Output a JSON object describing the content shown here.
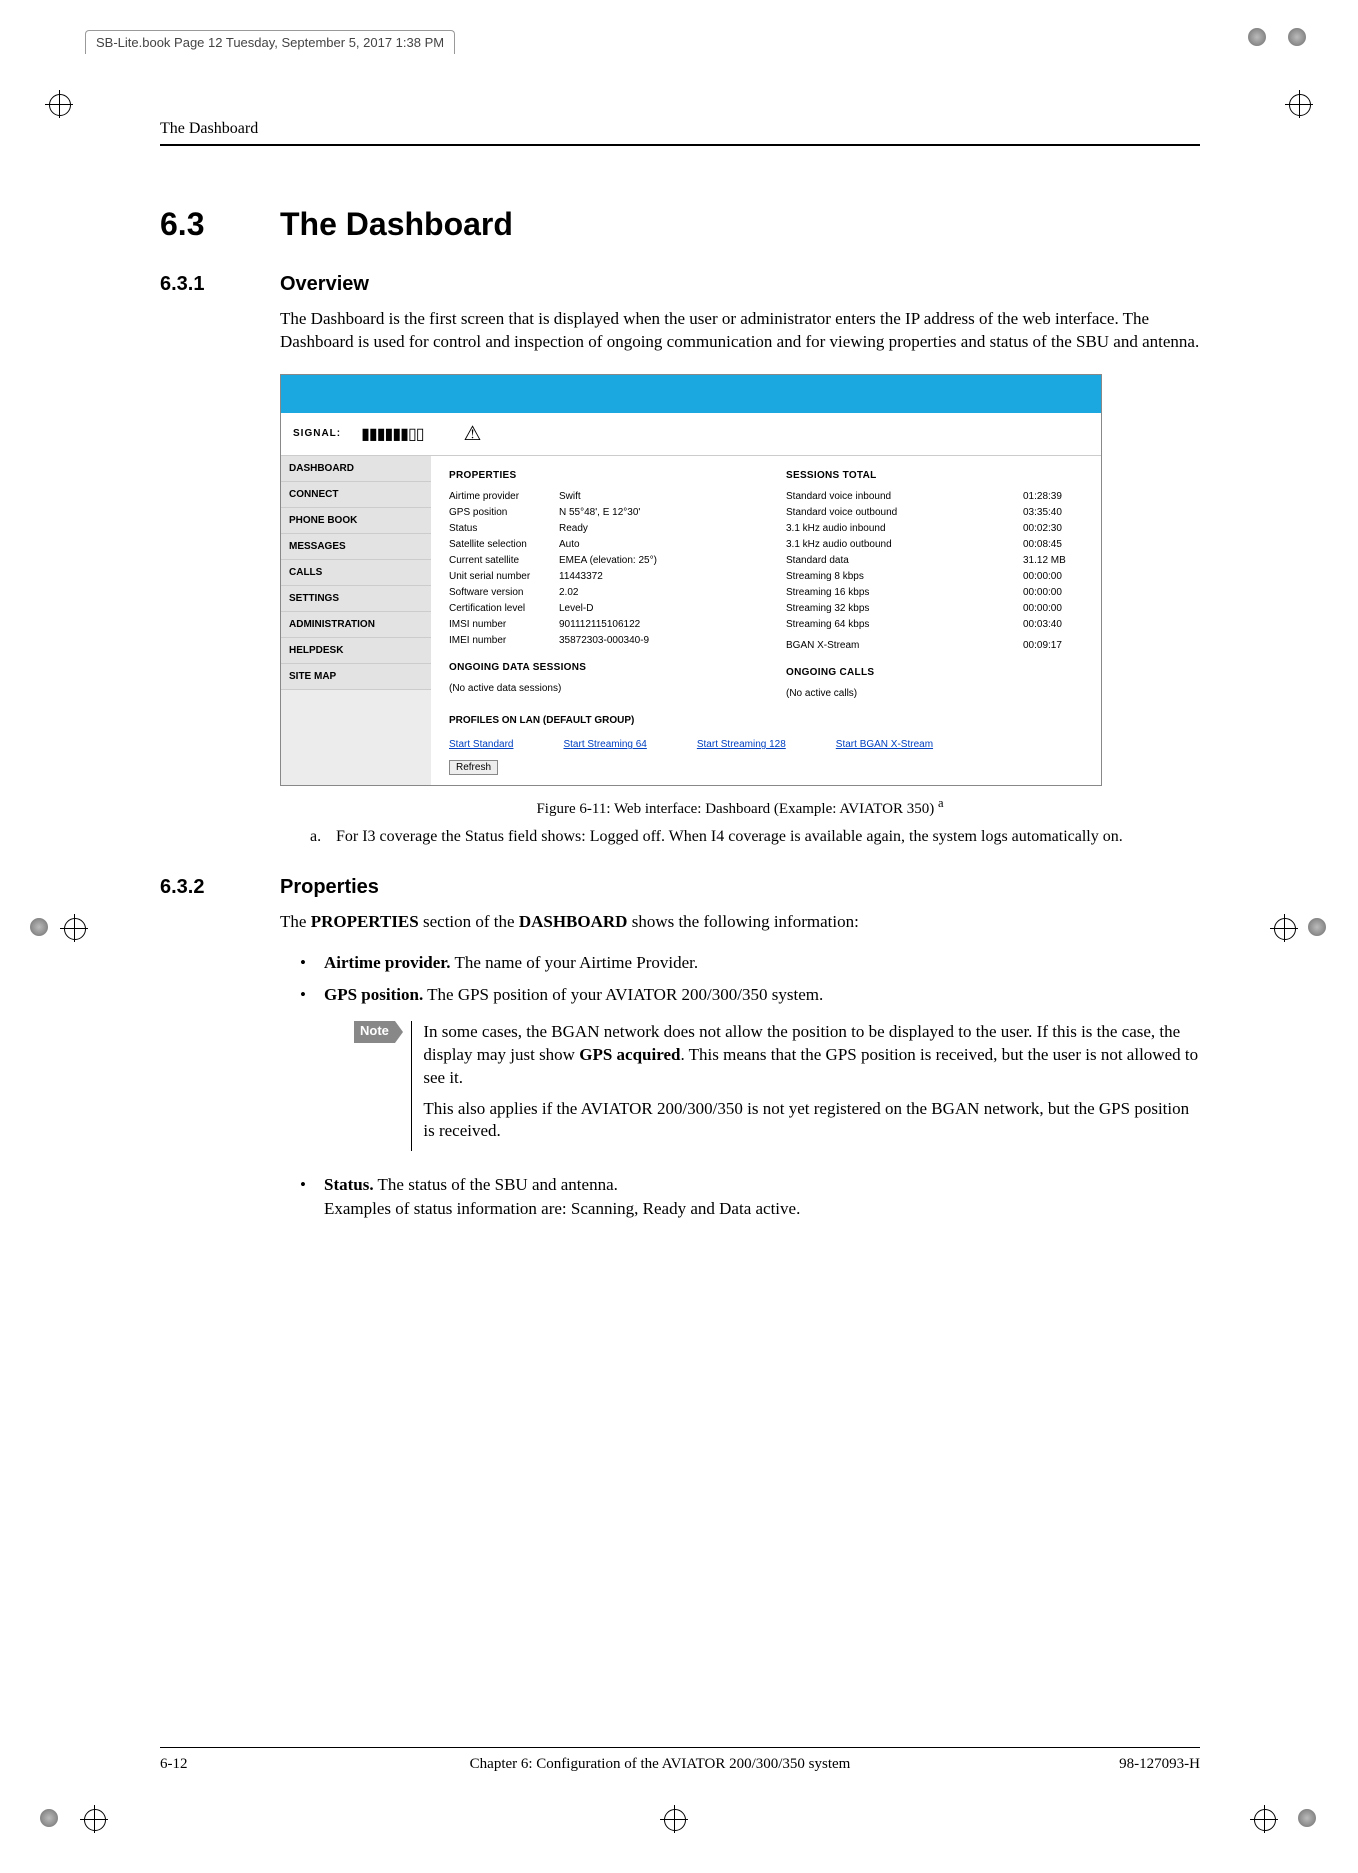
{
  "book_header": "SB-Lite.book  Page 12  Tuesday, September 5, 2017  1:38 PM",
  "running_head": "The Dashboard",
  "sec": {
    "num": "6.3",
    "title": "The Dashboard"
  },
  "sub1": {
    "num": "6.3.1",
    "title": "Overview"
  },
  "overview_para": "The Dashboard is the first screen that is displayed when the user or administrator enters the IP address of the web interface. The Dashboard is used for control and inspection of ongoing communication and for viewing properties and status of the SBU and antenna.",
  "signal": {
    "label": "SIGNAL:",
    "bars": "▮▮▮▮▮▮▯▯",
    "warn": "⚠"
  },
  "nav": [
    "DASHBOARD",
    "CONNECT",
    "PHONE BOOK",
    "MESSAGES",
    "CALLS",
    "SETTINGS",
    "ADMINISTRATION",
    "HELPDESK",
    "SITE MAP"
  ],
  "props_heading": "PROPERTIES",
  "props": [
    {
      "k": "Airtime provider",
      "v": "Swift"
    },
    {
      "k": "GPS position",
      "v": "N 55°48', E 12°30'"
    },
    {
      "k": "Status",
      "v": "Ready"
    },
    {
      "k": "Satellite selection",
      "v": "Auto"
    },
    {
      "k": "Current satellite",
      "v": "EMEA (elevation: 25°)"
    },
    {
      "k": "Unit serial number",
      "v": "11443372"
    },
    {
      "k": "Software version",
      "v": "2.02"
    },
    {
      "k": "Certification level",
      "v": "Level-D"
    },
    {
      "k": "IMSI number",
      "v": "901112115106122"
    },
    {
      "k": "IMEI number",
      "v": "35872303-000340-9"
    }
  ],
  "sessions_heading": "SESSIONS TOTAL",
  "sessions": [
    {
      "k": "Standard voice inbound",
      "v": "01:28:39"
    },
    {
      "k": "Standard voice outbound",
      "v": "03:35:40"
    },
    {
      "k": "3.1 kHz audio inbound",
      "v": "00:02:30"
    },
    {
      "k": "3.1 kHz audio outbound",
      "v": "00:08:45"
    },
    {
      "k": "Standard data",
      "v": "31.12 MB"
    },
    {
      "k": "Streaming 8 kbps",
      "v": "00:00:00"
    },
    {
      "k": "Streaming 16 kbps",
      "v": "00:00:00"
    },
    {
      "k": "Streaming 32 kbps",
      "v": "00:00:00"
    },
    {
      "k": "Streaming 64 kbps",
      "v": "00:03:40"
    },
    {
      "k": "",
      "v": ""
    },
    {
      "k": "BGAN X-Stream",
      "v": "00:09:17"
    }
  ],
  "ongoing_data": {
    "h": "ONGOING DATA SESSIONS",
    "t": "(No active data sessions)"
  },
  "ongoing_calls": {
    "h": "ONGOING CALLS",
    "t": "(No active calls)"
  },
  "profiles_heading": "PROFILES ON LAN (DEFAULT GROUP)",
  "links": [
    "Start Standard",
    "Start Streaming 64",
    "Start Streaming 128",
    "Start BGAN X-Stream"
  ],
  "refresh": "Refresh",
  "caption": "Figure 6-11: Web interface: Dashboard (Example: AVIATOR 350) ",
  "caption_sup": "a",
  "footnote": {
    "mark": "a.",
    "text": "For I3 coverage the Status field shows: Logged off. When I4 coverage is available again, the system logs automatically on."
  },
  "sub2": {
    "num": "6.3.2",
    "title": "Properties"
  },
  "props_intro_pre": "The ",
  "props_intro_b1": "PROPERTIES",
  "props_intro_mid": " section of the ",
  "props_intro_b2": "DASHBOARD",
  "props_intro_post": " shows the following information:",
  "bullets": {
    "airtime": {
      "b": "Airtime provider.",
      "t": " The name of your Airtime Provider."
    },
    "gps": {
      "b": "GPS position.",
      "t": " The GPS position of your AVIATOR 200/300/350 system."
    },
    "status": {
      "b": "Status.",
      "t": " The status of the SBU and antenna.",
      "t2": "Examples of status information are: Scanning, Ready and Data active."
    }
  },
  "note": {
    "tag": "Note",
    "p1a": "In some cases, the BGAN network does not allow the position to be displayed to the user. If this is the case, the display may just show ",
    "p1b": "GPS acquired",
    "p1c": ". This means that the GPS position is received, but the user is not allowed to see it.",
    "p2": "This also applies if the AVIATOR 200/300/350 is not yet registered on the BGAN network, but the GPS position is received."
  },
  "footer": {
    "page": "6-12",
    "chapter": "Chapter 6:  Configuration of the AVIATOR 200/300/350 system",
    "doc": "98-127093-H"
  }
}
